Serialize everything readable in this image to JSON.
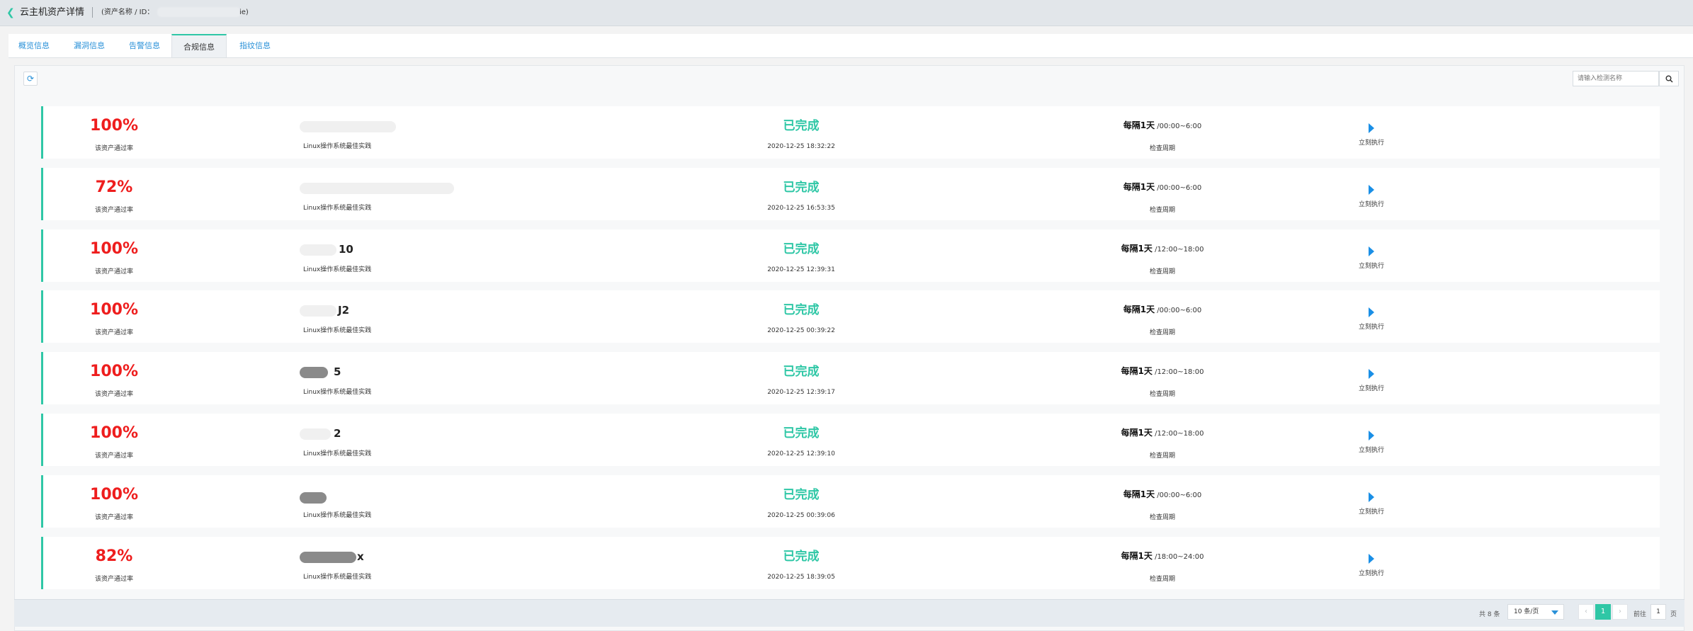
{
  "header": {
    "title": "云主机资产详情",
    "asset_label": "(资产名称 / ID：",
    "asset_suffix": "ie)"
  },
  "tabs": [
    {
      "label": "概览信息",
      "active": false
    },
    {
      "label": "漏洞信息",
      "active": false
    },
    {
      "label": "告警信息",
      "active": false
    },
    {
      "label": "合规信息",
      "active": true
    },
    {
      "label": "指纹信息",
      "active": false
    }
  ],
  "toolbar": {
    "search_placeholder": "请输入检测名称"
  },
  "rows": [
    {
      "pass_rate": "100%",
      "pass_rate_label": "该资产通过率",
      "name_tail": "",
      "policy": "Linux操作系统最佳实践",
      "status": "已完成",
      "time": "2020-12-25 18:32:22",
      "period_main": "每隔1天",
      "period_window": " /00:00~6:00",
      "period_label": "检查周期",
      "action": "立刻执行"
    },
    {
      "pass_rate": "72%",
      "pass_rate_label": "该资产通过率",
      "name_tail": "",
      "policy": "Linux操作系统最佳实践",
      "status": "已完成",
      "time": "2020-12-25 16:53:35",
      "period_main": "每隔1天",
      "period_window": " /00:00~6:00",
      "period_label": "检查周期",
      "action": "立刻执行"
    },
    {
      "pass_rate": "100%",
      "pass_rate_label": "该资产通过率",
      "name_tail": "10",
      "policy": "Linux操作系统最佳实践",
      "status": "已完成",
      "time": "2020-12-25 12:39:31",
      "period_main": "每隔1天",
      "period_window": " /12:00~18:00",
      "period_label": "检查周期",
      "action": "立刻执行"
    },
    {
      "pass_rate": "100%",
      "pass_rate_label": "该资产通过率",
      "name_tail": "J2",
      "policy": "Linux操作系统最佳实践",
      "status": "已完成",
      "time": "2020-12-25 00:39:22",
      "period_main": "每隔1天",
      "period_window": " /00:00~6:00",
      "period_label": "检查周期",
      "action": "立刻执行"
    },
    {
      "pass_rate": "100%",
      "pass_rate_label": "该资产通过率",
      "name_tail": "5",
      "policy": "Linux操作系统最佳实践",
      "status": "已完成",
      "time": "2020-12-25 12:39:17",
      "period_main": "每隔1天",
      "period_window": " /12:00~18:00",
      "period_label": "检查周期",
      "action": "立刻执行"
    },
    {
      "pass_rate": "100%",
      "pass_rate_label": "该资产通过率",
      "name_tail": "2",
      "policy": "Linux操作系统最佳实践",
      "status": "已完成",
      "time": "2020-12-25 12:39:10",
      "period_main": "每隔1天",
      "period_window": " /12:00~18:00",
      "period_label": "检查周期",
      "action": "立刻执行"
    },
    {
      "pass_rate": "100%",
      "pass_rate_label": "该资产通过率",
      "name_tail": "",
      "policy": "Linux操作系统最佳实践",
      "status": "已完成",
      "time": "2020-12-25 00:39:06",
      "period_main": "每隔1天",
      "period_window": " /00:00~6:00",
      "period_label": "检查周期",
      "action": "立刻执行"
    },
    {
      "pass_rate": "82%",
      "pass_rate_label": "该资产通过率",
      "name_tail": "x",
      "policy": "Linux操作系统最佳实践",
      "status": "已完成",
      "time": "2020-12-25 18:39:05",
      "period_main": "每隔1天",
      "period_window": " /18:00~24:00",
      "period_label": "检查周期",
      "action": "立刻执行"
    }
  ],
  "pagination": {
    "total": "共 8 条",
    "page_size": "10 条/页",
    "prev": "‹",
    "current": "1",
    "next": "›",
    "goto_label": "前往",
    "goto_value": "1",
    "page_unit": "页"
  },
  "colors": {
    "accent": "#2fc7a6",
    "pass_rate": "#ee1d1d",
    "link": "#2a91d8",
    "run_icon": "#1a8fe6"
  }
}
